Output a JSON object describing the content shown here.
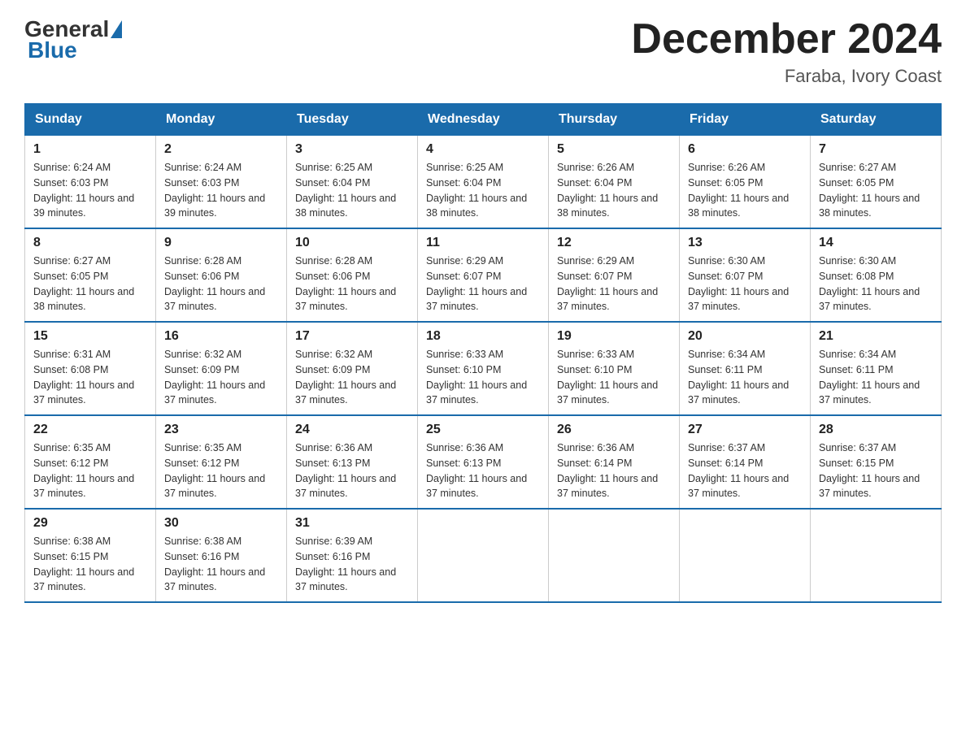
{
  "logo": {
    "text_general": "General",
    "text_blue": "Blue"
  },
  "header": {
    "month_year": "December 2024",
    "location": "Faraba, Ivory Coast"
  },
  "days_of_week": [
    "Sunday",
    "Monday",
    "Tuesday",
    "Wednesday",
    "Thursday",
    "Friday",
    "Saturday"
  ],
  "weeks": [
    [
      {
        "day": "1",
        "sunrise": "6:24 AM",
        "sunset": "6:03 PM",
        "daylight": "11 hours and 39 minutes."
      },
      {
        "day": "2",
        "sunrise": "6:24 AM",
        "sunset": "6:03 PM",
        "daylight": "11 hours and 39 minutes."
      },
      {
        "day": "3",
        "sunrise": "6:25 AM",
        "sunset": "6:04 PM",
        "daylight": "11 hours and 38 minutes."
      },
      {
        "day": "4",
        "sunrise": "6:25 AM",
        "sunset": "6:04 PM",
        "daylight": "11 hours and 38 minutes."
      },
      {
        "day": "5",
        "sunrise": "6:26 AM",
        "sunset": "6:04 PM",
        "daylight": "11 hours and 38 minutes."
      },
      {
        "day": "6",
        "sunrise": "6:26 AM",
        "sunset": "6:05 PM",
        "daylight": "11 hours and 38 minutes."
      },
      {
        "day": "7",
        "sunrise": "6:27 AM",
        "sunset": "6:05 PM",
        "daylight": "11 hours and 38 minutes."
      }
    ],
    [
      {
        "day": "8",
        "sunrise": "6:27 AM",
        "sunset": "6:05 PM",
        "daylight": "11 hours and 38 minutes."
      },
      {
        "day": "9",
        "sunrise": "6:28 AM",
        "sunset": "6:06 PM",
        "daylight": "11 hours and 37 minutes."
      },
      {
        "day": "10",
        "sunrise": "6:28 AM",
        "sunset": "6:06 PM",
        "daylight": "11 hours and 37 minutes."
      },
      {
        "day": "11",
        "sunrise": "6:29 AM",
        "sunset": "6:07 PM",
        "daylight": "11 hours and 37 minutes."
      },
      {
        "day": "12",
        "sunrise": "6:29 AM",
        "sunset": "6:07 PM",
        "daylight": "11 hours and 37 minutes."
      },
      {
        "day": "13",
        "sunrise": "6:30 AM",
        "sunset": "6:07 PM",
        "daylight": "11 hours and 37 minutes."
      },
      {
        "day": "14",
        "sunrise": "6:30 AM",
        "sunset": "6:08 PM",
        "daylight": "11 hours and 37 minutes."
      }
    ],
    [
      {
        "day": "15",
        "sunrise": "6:31 AM",
        "sunset": "6:08 PM",
        "daylight": "11 hours and 37 minutes."
      },
      {
        "day": "16",
        "sunrise": "6:32 AM",
        "sunset": "6:09 PM",
        "daylight": "11 hours and 37 minutes."
      },
      {
        "day": "17",
        "sunrise": "6:32 AM",
        "sunset": "6:09 PM",
        "daylight": "11 hours and 37 minutes."
      },
      {
        "day": "18",
        "sunrise": "6:33 AM",
        "sunset": "6:10 PM",
        "daylight": "11 hours and 37 minutes."
      },
      {
        "day": "19",
        "sunrise": "6:33 AM",
        "sunset": "6:10 PM",
        "daylight": "11 hours and 37 minutes."
      },
      {
        "day": "20",
        "sunrise": "6:34 AM",
        "sunset": "6:11 PM",
        "daylight": "11 hours and 37 minutes."
      },
      {
        "day": "21",
        "sunrise": "6:34 AM",
        "sunset": "6:11 PM",
        "daylight": "11 hours and 37 minutes."
      }
    ],
    [
      {
        "day": "22",
        "sunrise": "6:35 AM",
        "sunset": "6:12 PM",
        "daylight": "11 hours and 37 minutes."
      },
      {
        "day": "23",
        "sunrise": "6:35 AM",
        "sunset": "6:12 PM",
        "daylight": "11 hours and 37 minutes."
      },
      {
        "day": "24",
        "sunrise": "6:36 AM",
        "sunset": "6:13 PM",
        "daylight": "11 hours and 37 minutes."
      },
      {
        "day": "25",
        "sunrise": "6:36 AM",
        "sunset": "6:13 PM",
        "daylight": "11 hours and 37 minutes."
      },
      {
        "day": "26",
        "sunrise": "6:36 AM",
        "sunset": "6:14 PM",
        "daylight": "11 hours and 37 minutes."
      },
      {
        "day": "27",
        "sunrise": "6:37 AM",
        "sunset": "6:14 PM",
        "daylight": "11 hours and 37 minutes."
      },
      {
        "day": "28",
        "sunrise": "6:37 AM",
        "sunset": "6:15 PM",
        "daylight": "11 hours and 37 minutes."
      }
    ],
    [
      {
        "day": "29",
        "sunrise": "6:38 AM",
        "sunset": "6:15 PM",
        "daylight": "11 hours and 37 minutes."
      },
      {
        "day": "30",
        "sunrise": "6:38 AM",
        "sunset": "6:16 PM",
        "daylight": "11 hours and 37 minutes."
      },
      {
        "day": "31",
        "sunrise": "6:39 AM",
        "sunset": "6:16 PM",
        "daylight": "11 hours and 37 minutes."
      },
      null,
      null,
      null,
      null
    ]
  ]
}
